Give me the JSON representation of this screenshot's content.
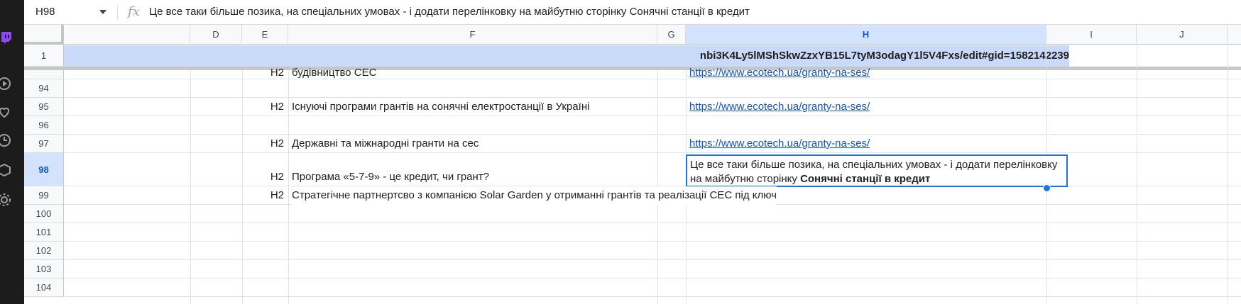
{
  "formula_bar": {
    "cell_ref": "H98",
    "fx_label": "fx",
    "formula": "Це все таки більше позика, на спеціальних умовах - і додати перелінковку на майбутню сторінку Сонячні станції в кредит"
  },
  "columns": [
    "D",
    "E",
    "F",
    "G",
    "H",
    "I",
    "J"
  ],
  "rows": [
    "1",
    "94",
    "95",
    "96",
    "97",
    "98",
    "99",
    "100",
    "101",
    "102",
    "103",
    "104"
  ],
  "row1_text": "nbi3K4Ly5lMShSkwZzxYB15L7tyM3odagY1l5V4Fxs/edit#gid=1582142239",
  "cells": {
    "r93": {
      "e": "H2",
      "f": "будівництво СЕС",
      "h": "https://www.ecotech.ua/granty-na-ses/"
    },
    "r95": {
      "e": "H2",
      "f": "Існуючі програми грантів на сонячні електростанції в Україні",
      "h": "https://www.ecotech.ua/granty-na-ses/"
    },
    "r97": {
      "e": "H2",
      "f": "Державні та міжнародні гранти на сес",
      "h": "https://www.ecotech.ua/granty-na-ses/"
    },
    "r98": {
      "e": "H2",
      "f": "Програма «5-7-9» - це кредит, чи грант?",
      "h_part1": "Це все таки більше позика, на спеціальних умовах - і додати перелінковку на майбутню сторінку ",
      "h_bold": "Сонячні станції в кредит"
    },
    "r99": {
      "e": "H2",
      "f": "Стратегічне партнертсво з компанією Solar Garden у отриманні грантів та реалізації СЕС під ключ"
    }
  },
  "side_icons": [
    "twitch-icon",
    "play-circle-icon",
    "heart-icon",
    "clock-icon",
    "cube-icon",
    "gear-icon"
  ],
  "colors": {
    "selection": "#1a73e8",
    "link": "#1155cc",
    "header_selected": "#d3e3fd",
    "row1_fill": "#c9daf8"
  }
}
